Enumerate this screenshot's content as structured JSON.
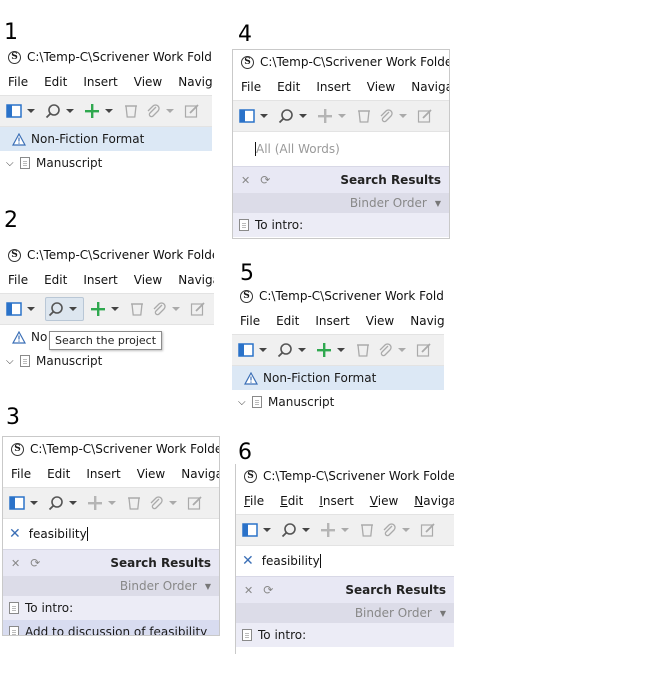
{
  "panels": [
    {
      "number": "1",
      "title_path": "C:\\Temp-C\\Scrivener Work Folder\\"
    },
    {
      "number": "2",
      "title_path": "C:\\Temp-C\\Scrivener Work Folder\\",
      "tooltip": "Search the project"
    },
    {
      "number": "3",
      "title_path": "C:\\Temp-C\\Scrivener Work Folder\\L"
    },
    {
      "number": "4",
      "title_path": "C:\\Temp-C\\Scrivener Work Folder\\L"
    },
    {
      "number": "5",
      "title_path": "C:\\Temp-C\\Scrivener Work Folder\\"
    },
    {
      "number": "6",
      "title_path": "C:\\Temp-C\\Scrivener Work Folder\\L"
    }
  ],
  "app_logo_glyph": "S",
  "menu": [
    "File",
    "Edit",
    "Insert",
    "View",
    "Navigate"
  ],
  "binder": {
    "format_item": "Non-Fiction Format",
    "manuscript": "Manuscript",
    "partial_no": "No"
  },
  "search": {
    "query": "feasibility",
    "placeholder": "All (All Words)",
    "clear_glyph": "✕"
  },
  "search_results": {
    "title": "Search Results",
    "order": "Binder Order",
    "items": [
      "To intro:",
      "Add to discussion of feasibility"
    ]
  },
  "icons": {
    "layout": "layout-icon",
    "search": "magnifier-icon",
    "add": "plus-icon",
    "trash": "trash-icon",
    "attach": "paperclip-icon",
    "edit": "edit-icon",
    "warning": "warning-icon",
    "document": "document-icon"
  },
  "colors": {
    "accent_green": "#2fa84f",
    "layout_blue": "#2a72c9",
    "selection": "#dce8f5",
    "results_header": "#e8e8f4"
  }
}
